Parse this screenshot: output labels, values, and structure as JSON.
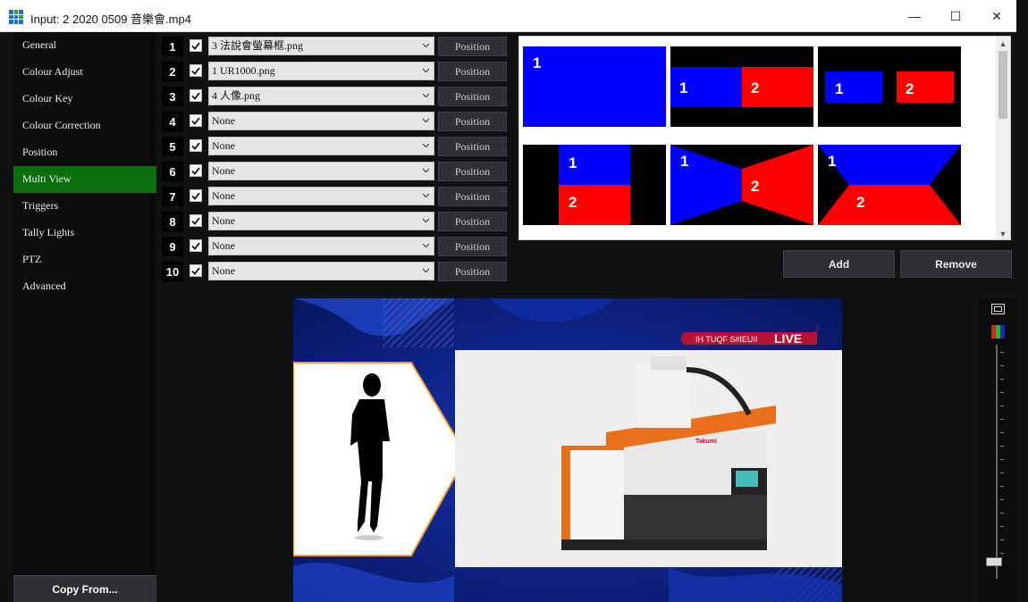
{
  "window": {
    "title": "Input: 2 2020 0509 音樂會.mp4",
    "buttons": {
      "minimize": "—",
      "maximize": "☐",
      "close": "✕"
    }
  },
  "sidebar": {
    "items": [
      {
        "label": "General"
      },
      {
        "label": "Colour Adjust"
      },
      {
        "label": "Colour Key"
      },
      {
        "label": "Colour Correction"
      },
      {
        "label": "Position"
      },
      {
        "label": "Multi View"
      },
      {
        "label": "Triggers"
      },
      {
        "label": "Tally Lights"
      },
      {
        "label": "PTZ"
      },
      {
        "label": "Advanced"
      }
    ],
    "active_label": "Multi View",
    "copy_from": "Copy From..."
  },
  "inputs": {
    "rows": [
      {
        "num": "1",
        "value": "3 法說會螢幕框.png",
        "checked": true,
        "position_label": "Position"
      },
      {
        "num": "2",
        "value": "1 UR1000.png",
        "checked": true,
        "position_label": "Position"
      },
      {
        "num": "3",
        "value": "4 人像.png",
        "checked": true,
        "position_label": "Position"
      },
      {
        "num": "4",
        "value": "None",
        "checked": true,
        "position_label": "Position"
      },
      {
        "num": "5",
        "value": "None",
        "checked": true,
        "position_label": "Position"
      },
      {
        "num": "6",
        "value": "None",
        "checked": true,
        "position_label": "Position"
      },
      {
        "num": "7",
        "value": "None",
        "checked": true,
        "position_label": "Position"
      },
      {
        "num": "8",
        "value": "None",
        "checked": true,
        "position_label": "Position"
      },
      {
        "num": "9",
        "value": "None",
        "checked": true,
        "position_label": "Position"
      },
      {
        "num": "10",
        "value": "None",
        "checked": true,
        "position_label": "Position"
      }
    ]
  },
  "layouts": {
    "thumbs": [
      {
        "labels": [
          "1"
        ]
      },
      {
        "labels": [
          "1",
          "2"
        ]
      },
      {
        "labels": [
          "1",
          "2"
        ]
      },
      {
        "labels": [
          "1",
          "2"
        ]
      },
      {
        "labels": [
          "1",
          "2"
        ]
      },
      {
        "labels": [
          "1",
          "2"
        ]
      }
    ],
    "colors": {
      "layer1": "#0000ff",
      "layer2": "#ff0000",
      "bg": "#000000"
    }
  },
  "actions": {
    "add": "Add",
    "remove": "Remove"
  },
  "preview": {
    "banner_text": "IH TUQF S#IEUII",
    "live_label": "LIVE",
    "machine_brand": "Takumi",
    "colors": {
      "background": "#0a1f7a",
      "live_red": "#c8102e",
      "frame_orange": "#f0a030"
    }
  },
  "colors": {
    "accent": "#0a6e0a"
  }
}
